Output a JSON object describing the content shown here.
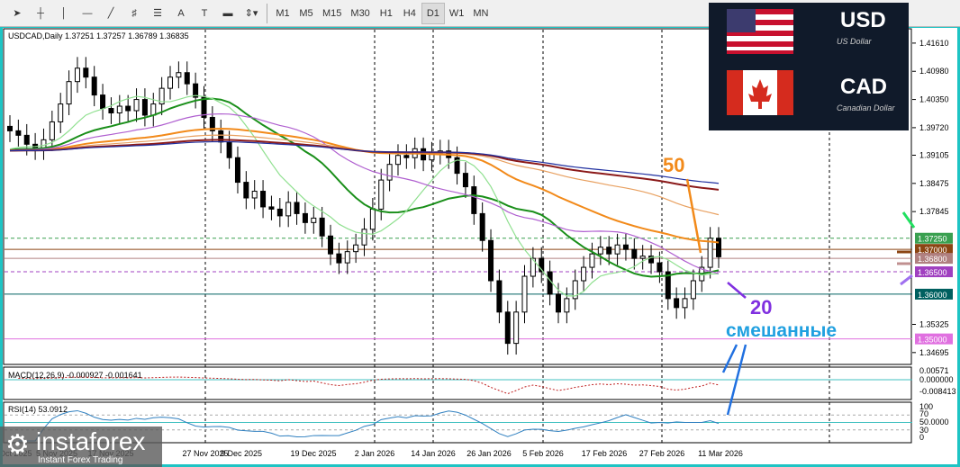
{
  "toolbar": {
    "tools": [
      "cursor",
      "crosshair",
      "vertical-line",
      "horizontal-line",
      "trendline",
      "fibonacci",
      "grid-lines",
      "text",
      "text-label",
      "rectangle",
      "arrows"
    ],
    "timeframes": [
      "M1",
      "M5",
      "M15",
      "M30",
      "H1",
      "H4",
      "D1",
      "W1",
      "MN"
    ],
    "active_timeframe": "D1"
  },
  "chart_data": {
    "type": "candlestick",
    "title": "USDCAD,Daily  1.37251 1.37257 1.36789 1.36835",
    "symbol": "USDCAD",
    "timeframe": "Daily",
    "ohlc_last": {
      "open": 1.37251,
      "high": 1.37257,
      "low": 1.36789,
      "close": 1.36835
    },
    "ylim": [
      1.3445,
      1.4195
    ],
    "y_ticks": [
      "1.41610",
      "1.40980",
      "1.40350",
      "1.39720",
      "1.39105",
      "1.38475",
      "1.37845",
      "1.35325",
      "1.34695"
    ],
    "x_ticks": [
      "24 Oct 2025",
      "5 Nov 2025",
      "17 Nov 2025",
      "27 Nov 2025",
      "9 Dec 2025",
      "19 Dec 2025",
      "2 Jan 2026",
      "14 Jan 2026",
      "26 Jan 2026",
      "5 Feb 2026",
      "17 Feb 2026",
      "27 Feb 2026",
      "11 Mar 2026"
    ],
    "closes": [
      1.3965,
      1.3955,
      1.3935,
      1.3925,
      1.3945,
      1.3985,
      1.4025,
      1.4075,
      1.4105,
      1.4085,
      1.4045,
      1.4015,
      1.4005,
      1.402,
      1.401,
      1.4035,
      1.4,
      1.4025,
      1.406,
      1.4085,
      1.4095,
      1.407,
      1.404,
      1.3995,
      1.3965,
      1.394,
      1.3905,
      1.385,
      1.3815,
      1.383,
      1.3795,
      1.379,
      1.3775,
      1.3805,
      1.378,
      1.376,
      1.377,
      1.373,
      1.369,
      1.367,
      1.3695,
      1.371,
      1.3745,
      1.379,
      1.3855,
      1.389,
      1.391,
      1.3905,
      1.3925,
      1.39,
      1.3915,
      1.392,
      1.3905,
      1.387,
      1.384,
      1.378,
      1.372,
      1.363,
      1.356,
      1.349,
      1.356,
      1.364,
      1.368,
      1.365,
      1.36,
      1.356,
      1.359,
      1.363,
      1.366,
      1.369,
      1.3705,
      1.369,
      1.371,
      1.37,
      1.368,
      1.3685,
      1.367,
      1.365,
      1.359,
      1.357,
      1.359,
      1.363,
      1.366,
      1.3725,
      1.36835
    ],
    "moving_averages": [
      {
        "label": "20",
        "period": 20,
        "color": "#1a8f1a"
      },
      {
        "label": "50",
        "period": 50,
        "color": "#f28a1a"
      },
      {
        "period": 10,
        "color": "#90e090"
      },
      {
        "period": 30,
        "color": "#b060d0"
      },
      {
        "period": 70,
        "color": "#e8a060"
      },
      {
        "period": 100,
        "color": "#8b1a1a"
      },
      {
        "period": 120,
        "color": "#2030a0"
      }
    ],
    "levels": [
      {
        "value": 1.3725,
        "label": "1.37250",
        "color": "#3aa050",
        "style": "dashed"
      },
      {
        "value": 1.37,
        "label": "1.37000",
        "color": "#8b4513"
      },
      {
        "value": 1.368,
        "label": "1.36800",
        "color": "#b08080"
      },
      {
        "value": 1.365,
        "label": "1.36500",
        "color": "#a040c0",
        "style": "dashed"
      },
      {
        "value": 1.36,
        "label": "1.36000",
        "color": "#006060"
      },
      {
        "value": 1.35,
        "label": "1.35000",
        "color": "#e070e0"
      }
    ],
    "macd": {
      "label": "MACD(12,26,9) -0.000927 -0.001641",
      "ticks": [
        "0.00571",
        "0.000000",
        "-0.008413"
      ]
    },
    "rsi": {
      "label": "RSI(14) 53.0912",
      "ticks": [
        "100",
        "70",
        "50.0000",
        "30",
        "0"
      ],
      "value": 53.0912
    }
  },
  "annotations": {
    "ma50": "50",
    "ma20": "20",
    "mixed": "смешанные"
  },
  "flags": {
    "usd_code": "USD",
    "usd_name": "US Dollar",
    "cad_code": "CAD",
    "cad_name": "Canadian Dollar"
  },
  "logo": {
    "name": "instaforex",
    "tagline": "Instant Forex Trading"
  }
}
